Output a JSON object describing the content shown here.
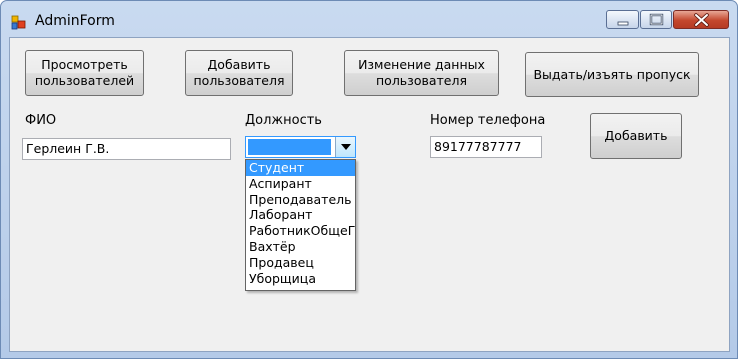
{
  "window": {
    "title": "AdminForm"
  },
  "buttons": {
    "view_users": "Просмотреть пользователей",
    "add_user": "Добавить пользователя",
    "edit_user": "Изменение данных пользователя",
    "pass": "Выдать/изъять пропуск",
    "add": "Добавить"
  },
  "form": {
    "fio_label": "ФИО",
    "fio_value": "Герлеин Г.В.",
    "position_label": "Должность",
    "phone_label": "Номер телефона",
    "phone_value": "89177787777"
  },
  "positions": [
    "Студент",
    "Аспирант",
    "Преподаватель",
    "Лаборант",
    "РаботникОбщеГ",
    "Вахтёр",
    "Продавец",
    "Уборщица"
  ],
  "highlighted_position": "Студент",
  "colors": {
    "selection": "#3399ff",
    "close_button": "#c4482e"
  }
}
